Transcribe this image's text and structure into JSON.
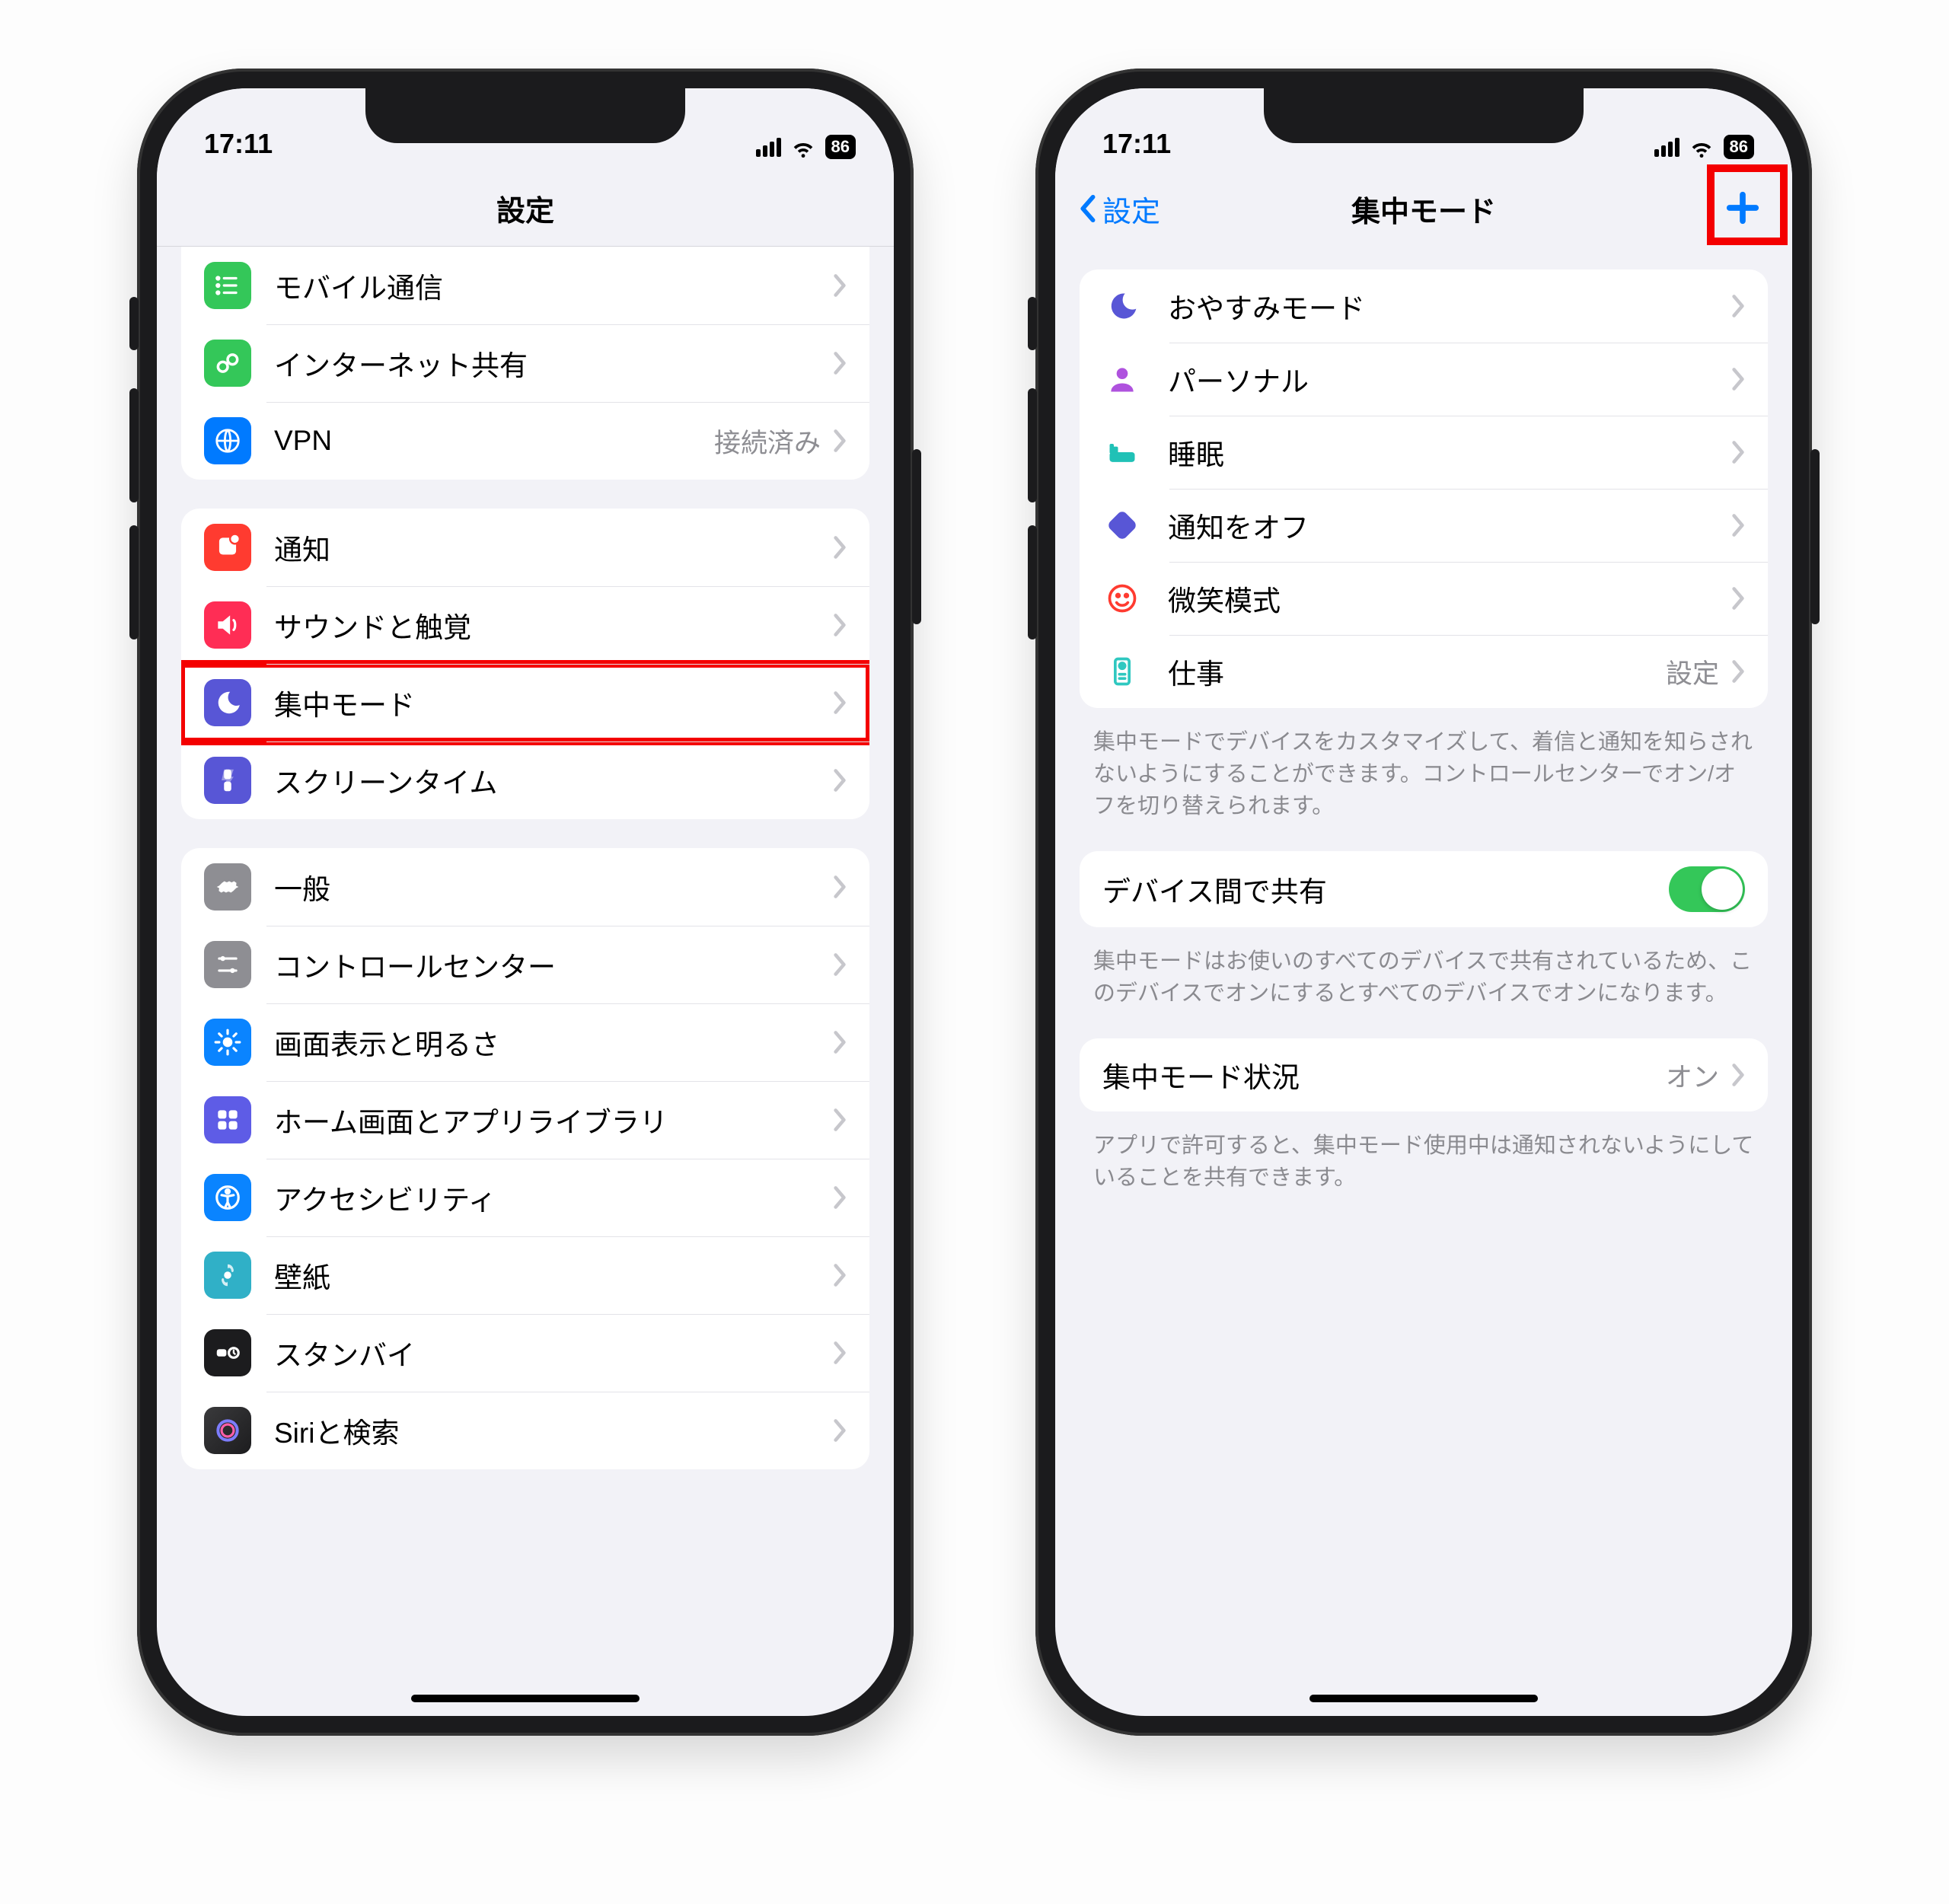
{
  "status": {
    "time": "17:11",
    "battery": "86"
  },
  "left": {
    "title": "設定",
    "groups": {
      "net": [
        {
          "name": "mobile",
          "label": "モバイル通信",
          "color": "bg-green"
        },
        {
          "name": "hotspot",
          "label": "インターネット共有",
          "color": "bg-green2"
        },
        {
          "name": "vpn",
          "label": "VPN",
          "detail": "接続済み",
          "color": "bg-blue"
        }
      ],
      "notif": [
        {
          "name": "notifications",
          "label": "通知",
          "color": "bg-red"
        },
        {
          "name": "sounds",
          "label": "サウンドと触覚",
          "color": "bg-pink"
        },
        {
          "name": "focus",
          "label": "集中モード",
          "color": "bg-indigo",
          "highlight": true
        },
        {
          "name": "screentime",
          "label": "スクリーンタイム",
          "color": "bg-indigo"
        }
      ],
      "general": [
        {
          "name": "general",
          "label": "一般",
          "color": "bg-gray"
        },
        {
          "name": "control-center",
          "label": "コントロールセンター",
          "color": "bg-gray2"
        },
        {
          "name": "display",
          "label": "画面表示と明るさ",
          "color": "bg-bluel"
        },
        {
          "name": "home",
          "label": "ホーム画面とアプリライブラリ",
          "color": "bg-purple"
        },
        {
          "name": "accessibility",
          "label": "アクセシビリティ",
          "color": "bg-bluel"
        },
        {
          "name": "wallpaper",
          "label": "壁紙",
          "color": "bg-teal"
        },
        {
          "name": "standby",
          "label": "スタンバイ",
          "color": "bg-black"
        },
        {
          "name": "siri",
          "label": "Siriと検索",
          "color": "siri"
        }
      ]
    }
  },
  "right": {
    "back": "設定",
    "title": "集中モード",
    "modes": [
      {
        "name": "dnd",
        "label": "おやすみモード",
        "iconColor": "#5856d6"
      },
      {
        "name": "personal",
        "label": "パーソナル",
        "iconColor": "#af52de"
      },
      {
        "name": "sleep",
        "label": "睡眠",
        "iconColor": "#20c1b6"
      },
      {
        "name": "silence",
        "label": "通知をオフ",
        "iconColor": "#5856d6"
      },
      {
        "name": "smile",
        "label": "微笑模式",
        "iconColor": "#ff3b30"
      },
      {
        "name": "work",
        "label": "仕事",
        "detail": "設定",
        "iconColor": "#2fc8c0"
      }
    ],
    "footer1": "集中モードでデバイスをカスタマイズして、着信と通知を知らされないようにすることができます。コントロールセンターでオン/オフを切り替えられます。",
    "share_label": "デバイス間で共有",
    "footer2": "集中モードはお使いのすべてのデバイスで共有されているため、このデバイスでオンにするとすべてのデバイスでオンになります。",
    "status_label": "集中モード状況",
    "status_value": "オン",
    "footer3": "アプリで許可すると、集中モード使用中は通知されないようにしていることを共有できます。"
  }
}
